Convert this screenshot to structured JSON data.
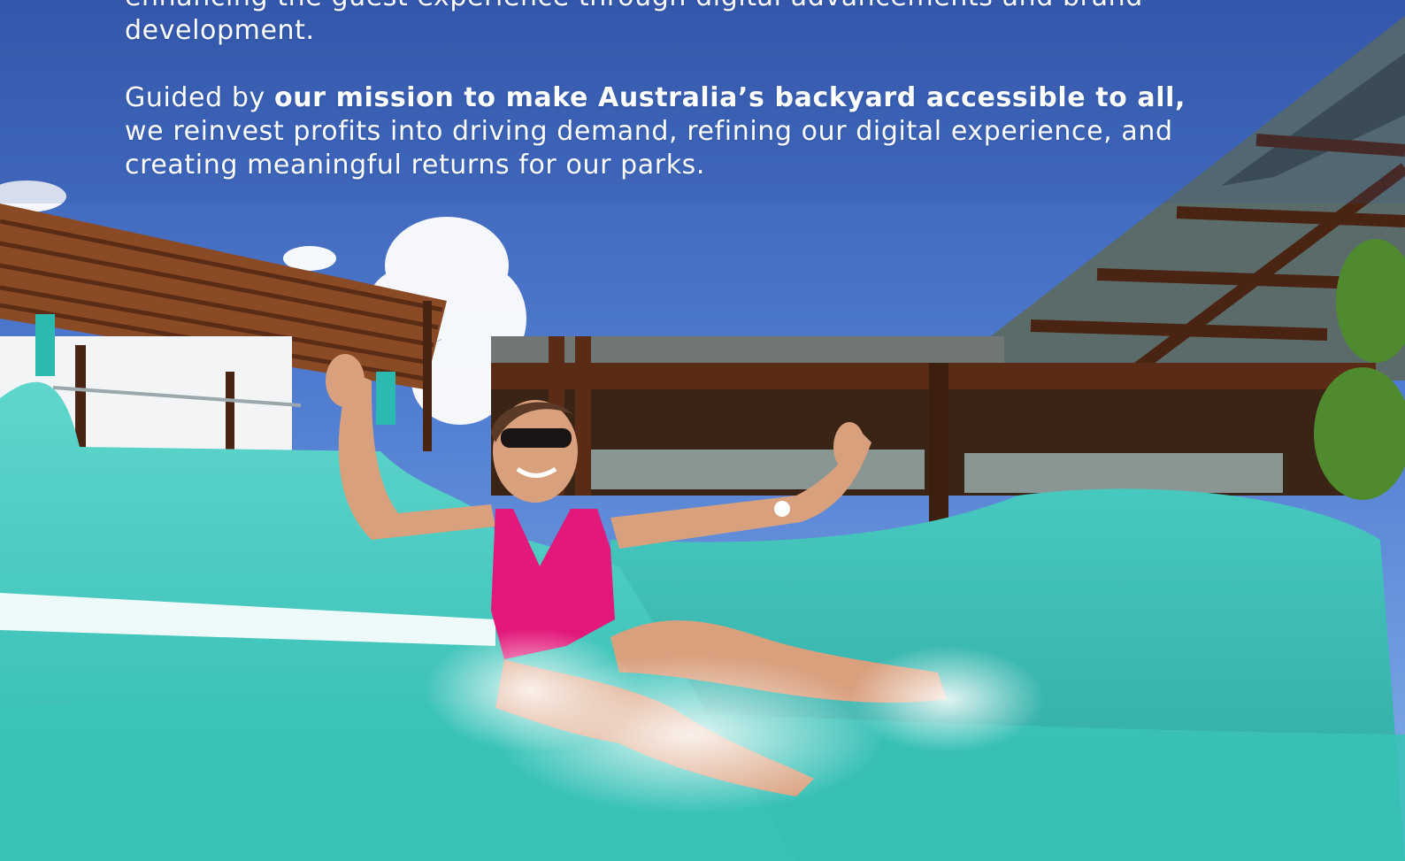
{
  "intro": {
    "line_1": "enhancing the guest experience through digital advancements and brand",
    "line_2": "development."
  },
  "mission": {
    "lead": "Guided by ",
    "emphasis": "our mission to make Australia’s backyard accessible to all,",
    "rest": " we reinvest profits into driving demand, refining our digital experience, and creating meaningful returns for our parks."
  },
  "colors": {
    "sky_top": "#3b63b6",
    "sky_bottom": "#7aa6e6",
    "slide_teal": "#3cc7bd",
    "slide_light": "#8fe3d9",
    "pergola_wood": "#6b3a1f",
    "swimsuit_pink": "#e2187a",
    "text": "#ffffff"
  },
  "photo": {
    "alt": "Woman in a pink swimsuit and sunglasses sliding down a turquoise water slide, arms raised, splashing water, under a timber pergola and blue sky."
  }
}
